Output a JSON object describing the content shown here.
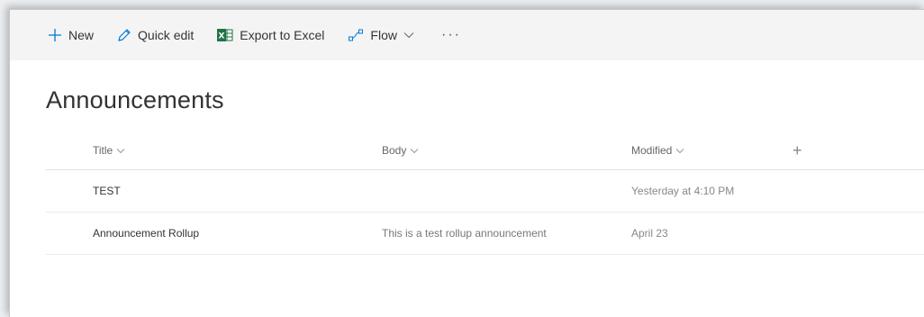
{
  "toolbar": {
    "new_label": "New",
    "quick_edit_label": "Quick edit",
    "export_label": "Export to Excel",
    "flow_label": "Flow",
    "more_label": "···"
  },
  "page": {
    "title": "Announcements"
  },
  "list": {
    "columns": [
      "Title",
      "Body",
      "Modified"
    ],
    "add_column": "+",
    "rows": [
      {
        "title": "TEST",
        "body": "",
        "modified": "Yesterday at 4:10 PM"
      },
      {
        "title": "Announcement Rollup",
        "body": "This is a test rollup announcement",
        "modified": "April 23"
      }
    ]
  },
  "colors": {
    "command_bar_bg": "#f4f4f4",
    "accent_blue": "#0078d4",
    "excel_green": "#217346"
  },
  "icons": [
    "plus-icon",
    "pencil-icon",
    "excel-icon",
    "flow-icon",
    "chevron-down-icon"
  ]
}
